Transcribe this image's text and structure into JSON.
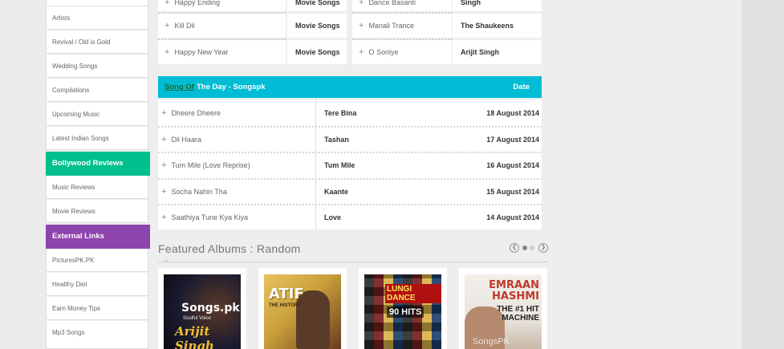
{
  "sidebar": {
    "links_top": [
      "Artists",
      "Revival / Old is Gold",
      "Wedding Songs",
      "Compilations",
      "Upcoming Music",
      "Latest Indian Songs"
    ],
    "section_reviews": {
      "label": "Bollywood Reviews",
      "color": "#00bf8f"
    },
    "links_reviews": [
      "Music Reviews",
      "Movie Reviews"
    ],
    "section_external": {
      "label": "External Links",
      "color": "#8e44ad"
    },
    "links_external": [
      "PicturesPK.PK",
      "Healthy Diet",
      "Earn Money Tips",
      "Mp3 Songs"
    ]
  },
  "top_table": {
    "rows": [
      {
        "song1": "Happy Ending",
        "sub1": "Movie Songs",
        "song2": "Dance Basanti",
        "sub2": "Singh"
      },
      {
        "song1": "Kill Dil",
        "sub1": "Movie Songs",
        "song2": "Manali Trance",
        "sub2": "The Shaukeens"
      },
      {
        "song1": "Happy New Year",
        "sub1": "Movie Songs",
        "song2": "O Soniye",
        "sub2": "Arijit Singh"
      }
    ]
  },
  "song_of_day": {
    "header_pre": "Song Of",
    "header_title": "The Day - Songspk",
    "header_date": "Date",
    "header_color": "#00bcd4",
    "rows": [
      {
        "song": "Dheere Dheere",
        "film": "Tere Bina",
        "date": "18 August 2014"
      },
      {
        "song": "Dil Haara",
        "film": "Tashan",
        "date": "17 August 2014"
      },
      {
        "song": "Tum Mile (Love Reprise)",
        "film": "Tum Mile",
        "date": "16 August 2014"
      },
      {
        "song": "Socha Nahin Tha",
        "film": "Kaante",
        "date": "15 August 2014"
      },
      {
        "song": "Saathiya Tune Kya Kiya",
        "film": "Love",
        "date": "14 August 2014"
      }
    ]
  },
  "featured": {
    "title": "Featured Albums : Random",
    "prev_icon": "chevron-left-icon",
    "next_icon": "chevron-right-icon",
    "albums": [
      {
        "cover_line1": "Songs.pk",
        "cover_line2": "Soulful Voice",
        "cover_line3": "Arijit Singh",
        "bg": "#1a1a2e"
      },
      {
        "cover_line1": "ATIF",
        "cover_line2": "THE HISTORY",
        "cover_line3": "",
        "bg": "#c9a03a"
      },
      {
        "cover_line1": "LUNGI DANCE",
        "cover_line2": "90 HITS",
        "cover_line3": "",
        "bg": "#2b2b2b"
      },
      {
        "cover_line1": "EMRAAN HASHMI",
        "cover_line2": "THE #1 HIT MACHINE",
        "cover_line3": "SongsPK",
        "bg": "#e9e4de"
      }
    ]
  }
}
